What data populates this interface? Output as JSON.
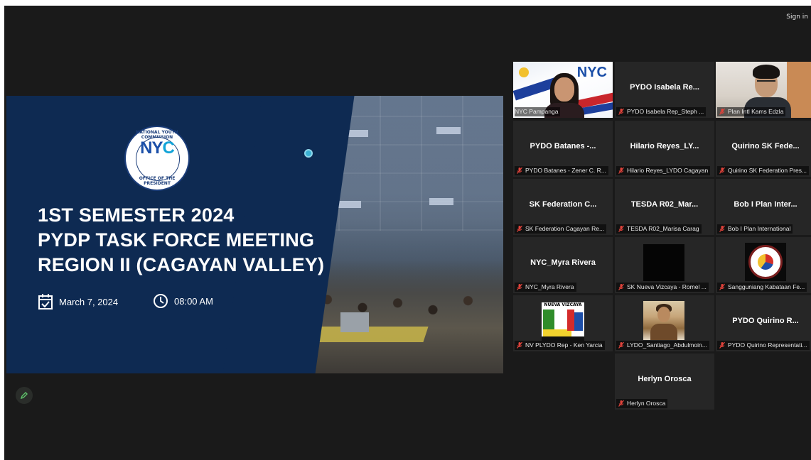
{
  "header": {
    "sign_in": "Sign in"
  },
  "slide": {
    "logo_mark_left": "NY",
    "logo_mark_right": "C",
    "logo_ring_top": "NATIONAL YOUTH COMMISSION",
    "logo_ring_bottom": "OFFICE OF THE PRESIDENT",
    "title_lines": [
      "1ST SEMESTER 2024",
      "PYDP TASK FORCE MEETING",
      "REGION II (CAGAYAN VALLEY)"
    ],
    "date": "March 7, 2024",
    "time": "08:00 AM"
  },
  "participants": [
    {
      "display": "",
      "label": "NYC Pampanga",
      "muted": false,
      "active": true,
      "kind": "video-pampanga"
    },
    {
      "display": "PYDO Isabela Re...",
      "label": "PYDO Isabela Rep_Steph ...",
      "muted": true,
      "kind": "name"
    },
    {
      "display": "",
      "label": "Plan Intl Kams Edzla",
      "muted": true,
      "kind": "video-plan"
    },
    {
      "display": "PYDO Batanes -...",
      "label": "PYDO Batanes - Zener C. R...",
      "muted": true,
      "kind": "name"
    },
    {
      "display": "Hilario Reyes_LY...",
      "label": "Hilario Reyes_LYDO Cagayan",
      "muted": true,
      "kind": "name"
    },
    {
      "display": "Quirino SK Fede...",
      "label": "Quirino SK Federation Pres...",
      "muted": true,
      "kind": "name"
    },
    {
      "display": "SK Federation C...",
      "label": "SK Federation Cagayan Re...",
      "muted": true,
      "kind": "name"
    },
    {
      "display": "TESDA R02_Mar...",
      "label": "TESDA R02_Marisa Carag",
      "muted": true,
      "kind": "name"
    },
    {
      "display": "Bob I Plan Inter...",
      "label": "Bob I Plan International",
      "muted": true,
      "kind": "name"
    },
    {
      "display": "NYC_Myra Rivera",
      "label": "NYC_Myra Rivera",
      "muted": true,
      "kind": "name"
    },
    {
      "display": "",
      "label": "SK Nueva Vizcaya - Romel ...",
      "muted": true,
      "kind": "black"
    },
    {
      "display": "",
      "label": "Sangguniang Kabataan Fe...",
      "muted": true,
      "kind": "seal"
    },
    {
      "display": "",
      "label": "NV PLYDO Rep - Ken Yarcia",
      "muted": true,
      "kind": "nv",
      "logo_text": "NUEVA VIZCAYA"
    },
    {
      "display": "",
      "label": "LYDO_Santiago_Abdulmoin...",
      "muted": true,
      "kind": "person"
    },
    {
      "display": "PYDO Quirino R...",
      "label": "PYDO Quirino Representati...",
      "muted": true,
      "kind": "name"
    },
    {
      "display": "Herlyn Orosca",
      "label": "Herlyn Orosca",
      "muted": true,
      "kind": "name"
    }
  ],
  "icons": {
    "calendar": "calendar-icon",
    "clock": "clock-icon",
    "mic_muted": "mic-muted-icon",
    "pen": "pen-icon"
  },
  "colors": {
    "slide_navy": "#0e2a52",
    "active_speaker": "#b7e02b",
    "muted_red": "#e0433b"
  }
}
